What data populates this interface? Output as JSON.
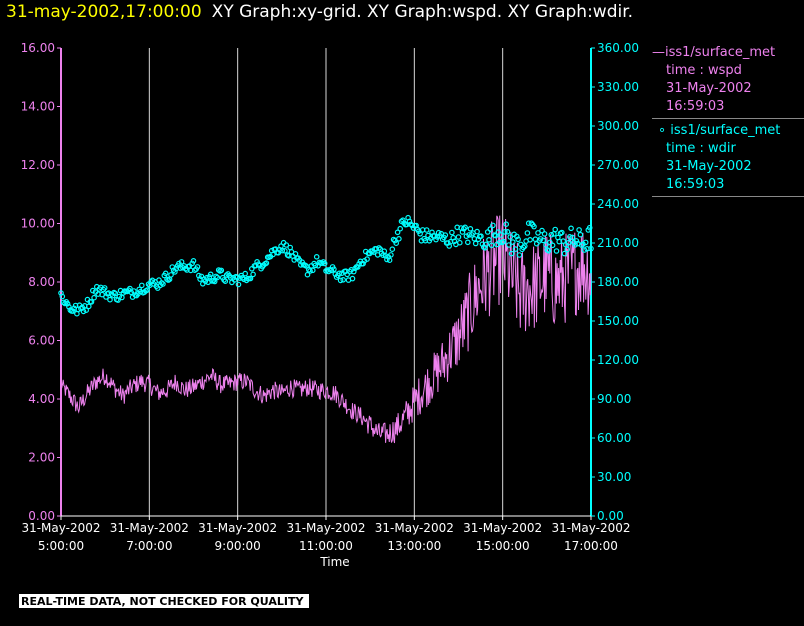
{
  "header": {
    "date": "31-may-2002,17:00:00",
    "titles": "XY Graph:xy-grid.  XY Graph:wspd.  XY Graph:wdir."
  },
  "notice": "REAL-TIME DATA, NOT CHECKED FOR QUALITY",
  "colors": {
    "wspd": "#ee82ee",
    "wdir": "#00ffff",
    "grid": "#ffffff",
    "background": "#000000"
  },
  "legend": {
    "wspd": {
      "name": "iss1/surface_met",
      "field": "time : wspd",
      "date": "31-May-2002",
      "time": "16:59:03"
    },
    "wdir": {
      "name": "iss1/surface_met",
      "field": "time : wdir",
      "date": "31-May-2002",
      "time": "16:59:03"
    }
  },
  "chart_data": {
    "type": "line",
    "xlabel": "Time",
    "x_ticks": [
      {
        "hour": 5,
        "date": "31-May-2002",
        "time": "5:00:00"
      },
      {
        "hour": 7,
        "date": "31-May-2002",
        "time": "7:00:00"
      },
      {
        "hour": 9,
        "date": "31-May-2002",
        "time": "9:00:00"
      },
      {
        "hour": 11,
        "date": "31-May-2002",
        "time": "11:00:00"
      },
      {
        "hour": 13,
        "date": "31-May-2002",
        "time": "13:00:00"
      },
      {
        "hour": 15,
        "date": "31-May-2002",
        "time": "15:00:00"
      },
      {
        "hour": 17,
        "date": "31-May-2002",
        "time": "17:00:00"
      }
    ],
    "xlim": [
      5,
      17
    ],
    "y_left": {
      "lim": [
        0,
        16
      ],
      "ticks": [
        "0.00",
        "2.00",
        "4.00",
        "6.00",
        "8.00",
        "10.00",
        "12.00",
        "14.00",
        "16.00"
      ]
    },
    "y_right": {
      "lim": [
        0,
        360
      ],
      "ticks": [
        "0.00",
        "30.00",
        "60.00",
        "90.00",
        "120.00",
        "150.00",
        "180.00",
        "210.00",
        "240.00",
        "270.00",
        "300.00",
        "330.00",
        "360.00"
      ]
    },
    "grid": "vertical",
    "series": [
      {
        "name": "iss1/surface_met",
        "field": "wspd",
        "axis": "left",
        "style": "line",
        "x": [
          5.0,
          5.2,
          5.4,
          5.6,
          5.8,
          6.0,
          6.2,
          6.4,
          6.6,
          6.8,
          7.0,
          7.2,
          7.4,
          7.6,
          7.8,
          8.0,
          8.2,
          8.4,
          8.6,
          8.8,
          9.0,
          9.2,
          9.4,
          9.6,
          9.8,
          10.0,
          10.2,
          10.4,
          10.6,
          10.8,
          11.0,
          11.2,
          11.4,
          11.6,
          11.8,
          12.0,
          12.2,
          12.4,
          12.6,
          12.8,
          13.0,
          13.2,
          13.4,
          13.6,
          13.8,
          14.0,
          14.2,
          14.4,
          14.6,
          14.8,
          15.0,
          15.2,
          15.4,
          15.6,
          15.8,
          16.0,
          16.2,
          16.4,
          16.6,
          16.8,
          17.0
        ],
        "y": [
          4.5,
          4.1,
          3.7,
          4.2,
          4.6,
          4.8,
          4.4,
          4.1,
          4.4,
          4.6,
          4.5,
          4.2,
          4.3,
          4.6,
          4.3,
          4.4,
          4.6,
          4.8,
          4.5,
          4.5,
          4.6,
          4.6,
          4.3,
          4.1,
          4.3,
          4.2,
          4.4,
          4.3,
          4.4,
          4.3,
          4.3,
          4.2,
          3.9,
          3.6,
          3.4,
          3.1,
          2.8,
          2.8,
          3.0,
          3.4,
          3.9,
          4.3,
          4.7,
          5.1,
          5.6,
          6.1,
          6.8,
          7.6,
          8.2,
          8.6,
          8.9,
          8.2,
          7.6,
          7.8,
          7.9,
          8.3,
          7.9,
          8.1,
          8.4,
          8.6,
          8.3
        ],
        "amp": [
          0.15,
          0.2,
          0.2,
          0.2,
          0.2,
          0.2,
          0.2,
          0.2,
          0.2,
          0.2,
          0.2,
          0.2,
          0.2,
          0.2,
          0.2,
          0.2,
          0.2,
          0.2,
          0.2,
          0.2,
          0.2,
          0.2,
          0.2,
          0.2,
          0.2,
          0.2,
          0.2,
          0.2,
          0.2,
          0.2,
          0.2,
          0.2,
          0.2,
          0.2,
          0.2,
          0.25,
          0.25,
          0.25,
          0.3,
          0.35,
          0.4,
          0.45,
          0.5,
          0.55,
          0.6,
          0.7,
          0.8,
          0.9,
          1.0,
          1.0,
          1.0,
          1.0,
          1.0,
          1.0,
          1.0,
          1.0,
          1.0,
          1.0,
          1.0,
          1.0,
          1.0
        ]
      },
      {
        "name": "iss1/surface_met",
        "field": "wdir",
        "axis": "right",
        "style": "markers",
        "x": [
          5.0,
          5.2,
          5.4,
          5.6,
          5.8,
          6.0,
          6.2,
          6.4,
          6.6,
          6.8,
          7.0,
          7.2,
          7.4,
          7.6,
          7.8,
          8.0,
          8.2,
          8.4,
          8.6,
          8.8,
          9.0,
          9.2,
          9.4,
          9.6,
          9.8,
          10.0,
          10.2,
          10.4,
          10.6,
          10.8,
          11.0,
          11.2,
          11.4,
          11.6,
          11.8,
          12.0,
          12.2,
          12.4,
          12.6,
          12.8,
          13.0,
          13.2,
          13.4,
          13.6,
          13.8,
          14.0,
          14.2,
          14.4,
          14.6,
          14.8,
          15.0,
          15.2,
          15.4,
          15.6,
          15.8,
          16.0,
          16.2,
          16.4,
          16.6,
          16.8,
          17.0
        ],
        "y": [
          170,
          160,
          158,
          163,
          175,
          172,
          169,
          171,
          172,
          175,
          178,
          179,
          184,
          191,
          192,
          193,
          181,
          183,
          186,
          182,
          182,
          183,
          191,
          196,
          203,
          208,
          203,
          193,
          189,
          196,
          190,
          187,
          184,
          186,
          197,
          202,
          205,
          197,
          216,
          227,
          222,
          215,
          215,
          214,
          212,
          217,
          216,
          214,
          212,
          217,
          219,
          210,
          209,
          217,
          213,
          211,
          213,
          210,
          213,
          210,
          214
        ],
        "amp": [
          3,
          3,
          3,
          3,
          3,
          3,
          3,
          3,
          3,
          3,
          3,
          3,
          3,
          3,
          3,
          3,
          3,
          3,
          3,
          3,
          3,
          3,
          3,
          3,
          3,
          3,
          3,
          3,
          3,
          3,
          3,
          3,
          3,
          3,
          3,
          3,
          3,
          3,
          4,
          4,
          4,
          4,
          4,
          4,
          4,
          5,
          5,
          5,
          5,
          6,
          7,
          7,
          7,
          7,
          7,
          7,
          7,
          7,
          7,
          7,
          7
        ]
      }
    ]
  }
}
